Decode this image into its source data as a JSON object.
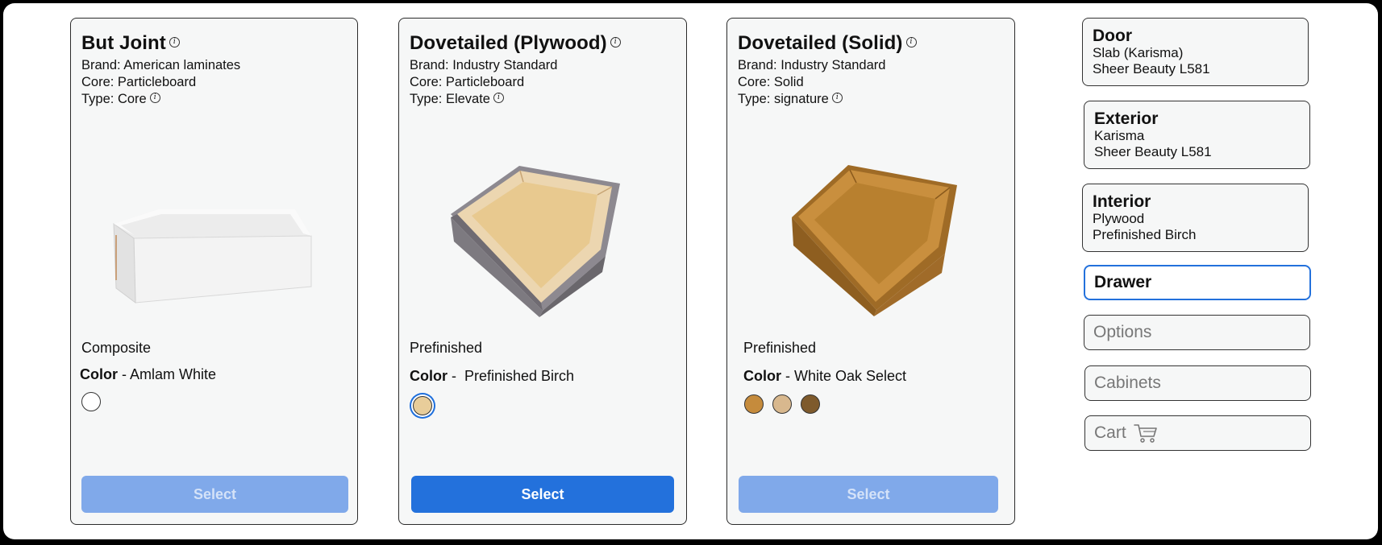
{
  "cards": [
    {
      "title": "But Joint",
      "brand": "Brand: American laminates",
      "core": "Core: Particleboard",
      "type": "Type: Core",
      "finish": "Composite",
      "color_label": "Color",
      "color_sep": " - ",
      "color_value": "Amlam White",
      "swatches": [
        "#ffffff"
      ],
      "select_label": "Select",
      "select_state": "disabled"
    },
    {
      "title": "Dovetailed (Plywood)",
      "brand": "Brand: Industry Standard",
      "core": "Core: Particleboard",
      "type": "Type: Elevate",
      "finish": "Prefinished",
      "color_label": "Color",
      "color_sep": " -  ",
      "color_value": "Prefinished Birch",
      "swatches": [
        "#e8cd9a"
      ],
      "select_label": "Select",
      "select_state": "active"
    },
    {
      "title": "Dovetailed (Solid)",
      "brand": "Brand: Industry Standard",
      "core": "Core: Solid",
      "type": "Type: signature",
      "finish": "Prefinished",
      "color_label": "Color",
      "color_sep": " - ",
      "color_value": "White Oak Select",
      "swatches": [
        "#c58b3c",
        "#d8b88e",
        "#7e5a2c"
      ],
      "select_label": "Select",
      "select_state": "disabled"
    }
  ],
  "sidebar": {
    "door": {
      "title": "Door",
      "line1": "Slab (Karisma)",
      "line2": "Sheer Beauty L581"
    },
    "exterior": {
      "title": "Exterior",
      "line1": "Karisma",
      "line2": "Sheer Beauty L581"
    },
    "interior": {
      "title": "Interior",
      "line1": "Plywood",
      "line2": "Prefinished Birch"
    },
    "drawer": "Drawer",
    "options": "Options",
    "cabinets": "Cabinets",
    "cart": "Cart"
  },
  "icons": {
    "info": "info-icon",
    "cart": "cart-icon"
  },
  "colors": {
    "accent": "#2371dc",
    "disabled_button": "#80a9ea"
  }
}
